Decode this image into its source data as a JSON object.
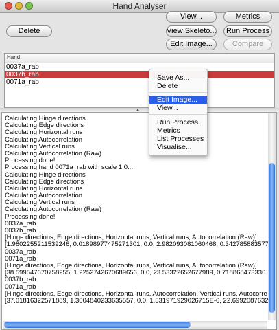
{
  "window": {
    "title": "Hand Analyser"
  },
  "buttons": {
    "delete": "Delete",
    "view": "View...",
    "metrics": "Metrics",
    "view_skeleton": "View Skeleto...",
    "run_process": "Run Process",
    "edit_image": "Edit Image...",
    "compare": "Compare"
  },
  "table": {
    "column": "Hand",
    "rows": [
      "0037a_rab",
      "0037b_rab",
      "0071a_rab"
    ],
    "selected_index": 1
  },
  "context_menu": {
    "items": [
      "Save As...",
      "Delete",
      "Edit Image...",
      "View...",
      "Run Process",
      "Metrics",
      "List Processes",
      "Visualise..."
    ],
    "highlighted": "Edit Image..."
  },
  "log": {
    "lines": [
      "Calculating Hinge directions",
      "Calculating Edge directions",
      "Calculating Horizontal runs",
      "Calculating Autocorrelation",
      "Calculating Vertical runs",
      "Calculating Autocorrelation (Raw)",
      "Processing done!",
      "Processing hand 0071a_rab with scale 1.0...",
      "Calculating Hinge directions",
      "Calculating Edge directions",
      "Calculating Horizontal runs",
      "Calculating Autocorrelation",
      "Calculating Vertical runs",
      "Calculating Autocorrelation (Raw)",
      "Processing done!",
      "0037a_rab",
      "0037b_rab",
      "[Hinge directions, Edge directions, Horizontal runs, Vertical runs, Autocorrelation (Raw)]",
      "[1.9802255211539246, 0.01898977475271301, 0.0, 2.982093081060468, 0.342785883577",
      "0037a_rab",
      "0071a_rab",
      "[Hinge directions, Edge directions, Horizontal runs, Vertical runs, Autocorrelation (Raw)]",
      "[38.599547670758255, 1.2252742670689656, 0.0, 23.53322652677989, 0.718868473330",
      "0037b_rab",
      "0071a_rab",
      "[Hinge directions, Edge directions, Horizontal runs, Autocorrelation, Vertical runs, Autocorre",
      "[37.01816322571889, 1.3004840233635557, 0.0, 1.531971929026715E-6, 22.69920876329"
    ]
  },
  "colors": {
    "selection": "#c83c3c",
    "menu_highlight": "#2a5ee6",
    "scroll_thumb": "#2f6fd6"
  }
}
